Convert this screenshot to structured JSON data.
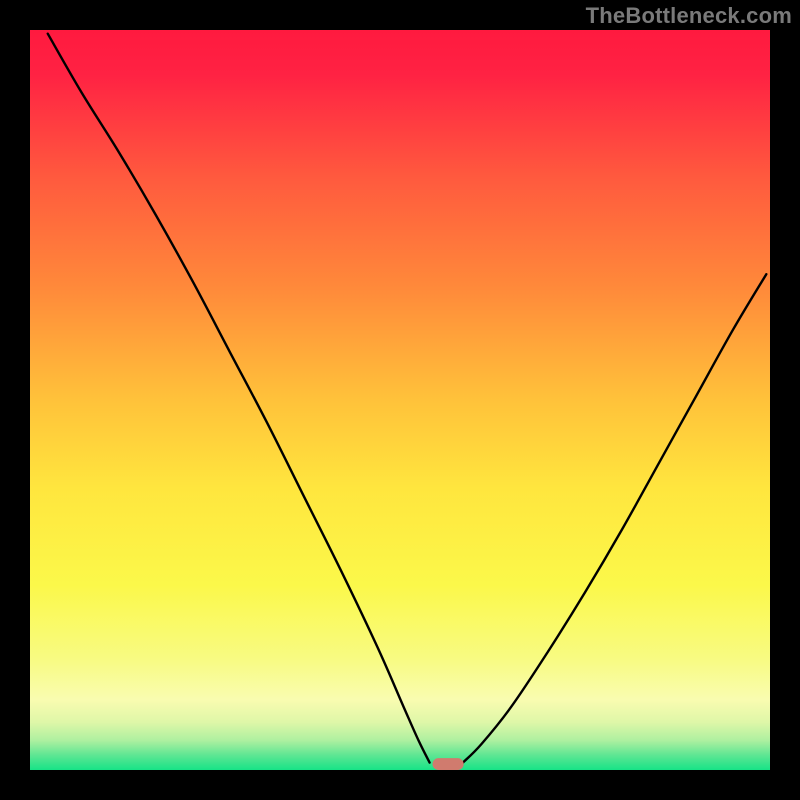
{
  "watermark": "TheBottleneck.com",
  "chart_data": {
    "type": "line",
    "title": "",
    "xlabel": "",
    "ylabel": "",
    "xlim": [
      0,
      100
    ],
    "ylim": [
      0,
      100
    ],
    "grid": false,
    "series": [
      {
        "name": "bottleneck-curve-left",
        "x": [
          2.4,
          7,
          12,
          17,
          22,
          27,
          32,
          37,
          42,
          47,
          50.5,
          52.5,
          54
        ],
        "values": [
          99.5,
          91.5,
          83.5,
          75,
          66,
          56.5,
          47,
          37,
          27,
          16.5,
          8.5,
          4,
          1
        ]
      },
      {
        "name": "bottleneck-curve-right",
        "x": [
          58.5,
          61,
          65,
          70,
          75,
          80,
          85,
          90,
          95,
          99.5
        ],
        "values": [
          1,
          3.5,
          8.5,
          16,
          24,
          32.5,
          41.5,
          50.5,
          59.5,
          67
        ]
      }
    ],
    "marker": {
      "name": "optimal-point",
      "x": 56.5,
      "y": 0.8,
      "width": 4.2,
      "height": 1.6,
      "color": "#d07b6e"
    },
    "background_gradient": [
      {
        "offset": 0.0,
        "color": "#ff1a3f"
      },
      {
        "offset": 0.06,
        "color": "#ff2243"
      },
      {
        "offset": 0.2,
        "color": "#ff5a3e"
      },
      {
        "offset": 0.35,
        "color": "#ff8a3a"
      },
      {
        "offset": 0.5,
        "color": "#ffc23a"
      },
      {
        "offset": 0.62,
        "color": "#ffe63e"
      },
      {
        "offset": 0.75,
        "color": "#fbf84a"
      },
      {
        "offset": 0.85,
        "color": "#f8fb82"
      },
      {
        "offset": 0.905,
        "color": "#f9fcb0"
      },
      {
        "offset": 0.935,
        "color": "#dff7a8"
      },
      {
        "offset": 0.96,
        "color": "#aef0a0"
      },
      {
        "offset": 0.98,
        "color": "#5ee693"
      },
      {
        "offset": 1.0,
        "color": "#17e387"
      }
    ]
  }
}
